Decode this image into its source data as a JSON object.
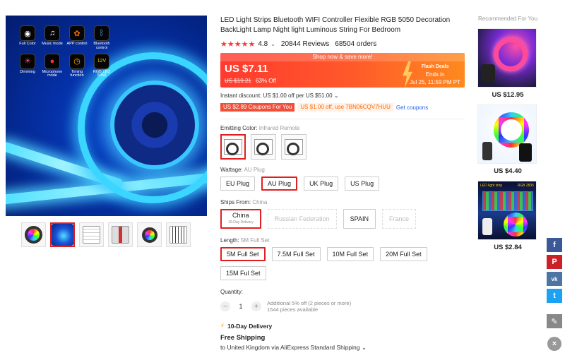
{
  "gallery": {
    "features": [
      {
        "label": "Full Color",
        "icon": "color-wheel-icon",
        "glyph": "◉"
      },
      {
        "label": "Music mode",
        "icon": "music-icon",
        "glyph": "♫"
      },
      {
        "label": "APP control",
        "icon": "app-icon",
        "glyph": "✿"
      },
      {
        "label": "Bluetooth control",
        "icon": "bluetooth-icon",
        "glyph": "ᛒ"
      },
      {
        "label": "Dimming",
        "icon": "dimming-icon",
        "glyph": "☀"
      },
      {
        "label": "Microphone mode",
        "icon": "microphone-icon",
        "glyph": "●"
      },
      {
        "label": "Timing function",
        "icon": "timer-icon",
        "glyph": "◷"
      },
      {
        "label": "RGB LED 5050",
        "icon": "voltage-icon",
        "glyph": "12V"
      }
    ],
    "thumbnails": 6,
    "active_thumbnail": 1
  },
  "product": {
    "title": "LED Light Strips Bluetooth WIFI Controller Flexible RGB 5050 Decoration BackLight Lamp Night light Luminous String For Bedroom",
    "stars": "★★★★★",
    "rating": "4.8",
    "reviews": "20844 Reviews",
    "orders": "68504 orders"
  },
  "price": {
    "banner": "Shop now & save more!",
    "current": "US $7.11",
    "original": "US $19.21",
    "discount": "63% Off",
    "flash_title": "Flash Deals",
    "flash_ends": "Ends in",
    "flash_time": "Jul 25, 11:59 PM PT",
    "instant": "Instant discount: US $1.00 off per US $51.00 ⌄"
  },
  "coupons": {
    "coupon1": "US $2.89 Coupons For You",
    "coupon2": "US $1.00 off, use 7BN06CQV7HUU",
    "get": "Get coupons"
  },
  "color": {
    "label": "Emitting Color:",
    "value": "Infrared Remote",
    "options": 3,
    "selected": 0
  },
  "wattage": {
    "label": "Wattage:",
    "value": "AU Plug",
    "options": [
      "EU Plug",
      "AU Plug",
      "UK Plug",
      "US Plug"
    ]
  },
  "ships": {
    "label": "Ships From:",
    "value": "China",
    "options": [
      {
        "name": "China",
        "sub": "10-Day Delivery"
      },
      {
        "name": "Russian Federation",
        "sub": ""
      },
      {
        "name": "SPAIN",
        "sub": ""
      },
      {
        "name": "France",
        "sub": ""
      }
    ]
  },
  "length": {
    "label": "Length:",
    "value": "5M Full Set",
    "options": [
      "5M Full Set",
      "7.5M Full Set",
      "10M Full Set",
      "20M Full Set",
      "15M Ful Set"
    ]
  },
  "quantity": {
    "label": "Quantity:",
    "value": "1",
    "minus": "−",
    "plus": "+",
    "note1": "Additional 5% off (2 pieces or more)",
    "note2": "1544 pieces available"
  },
  "shipping": {
    "delivery": "10-Day Delivery",
    "free": "Free Shipping",
    "to": "to United Kingdom via AliExpress Standard Shipping ⌄"
  },
  "recommended": {
    "title": "Recommended For You",
    "items": [
      {
        "price": "US $12.95"
      },
      {
        "price": "US $4.40"
      },
      {
        "price": "US $2.84"
      }
    ],
    "badge": "LED light strip",
    "badge2": "RGB 2835"
  },
  "social": {
    "facebook": "f",
    "pinterest": "P",
    "vk": "vk",
    "twitter": "t",
    "edit": "✎",
    "close": "×"
  }
}
